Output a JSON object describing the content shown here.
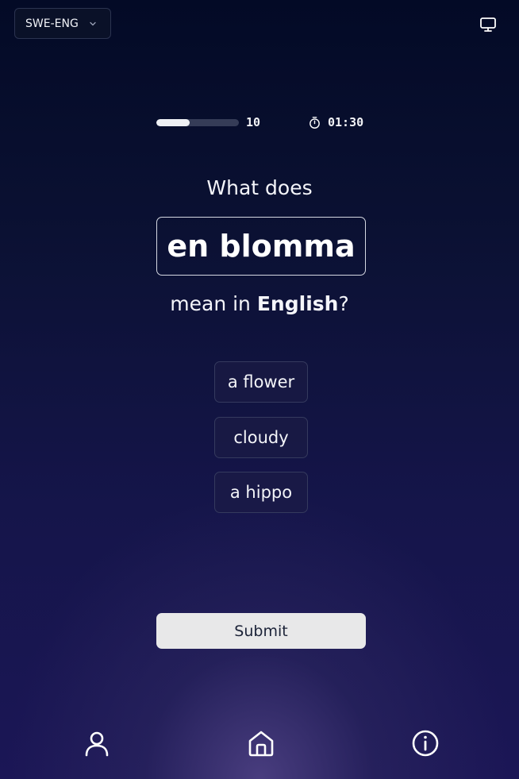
{
  "header": {
    "language_pair": "SWE-ENG",
    "language_chevron_icon": "chevron-down-icon",
    "display_icon": "monitor-icon"
  },
  "progress": {
    "fraction": 0.4,
    "count": "10",
    "timer_icon": "stopwatch-icon",
    "timer": "01:30"
  },
  "question": {
    "prefix": "What does",
    "word": "en blomma",
    "suffix_start": "mean in ",
    "target_language": "English",
    "suffix_end": "?"
  },
  "options": [
    "a flower",
    "cloudy",
    "a hippo"
  ],
  "submit_label": "Submit",
  "bottom_nav": {
    "profile_icon": "user-icon",
    "home_icon": "home-icon",
    "info_icon": "info-icon"
  },
  "colors": {
    "background_top": "#030a26",
    "background_bottom": "#1b1656",
    "submit_bg": "#e8e8e9"
  }
}
